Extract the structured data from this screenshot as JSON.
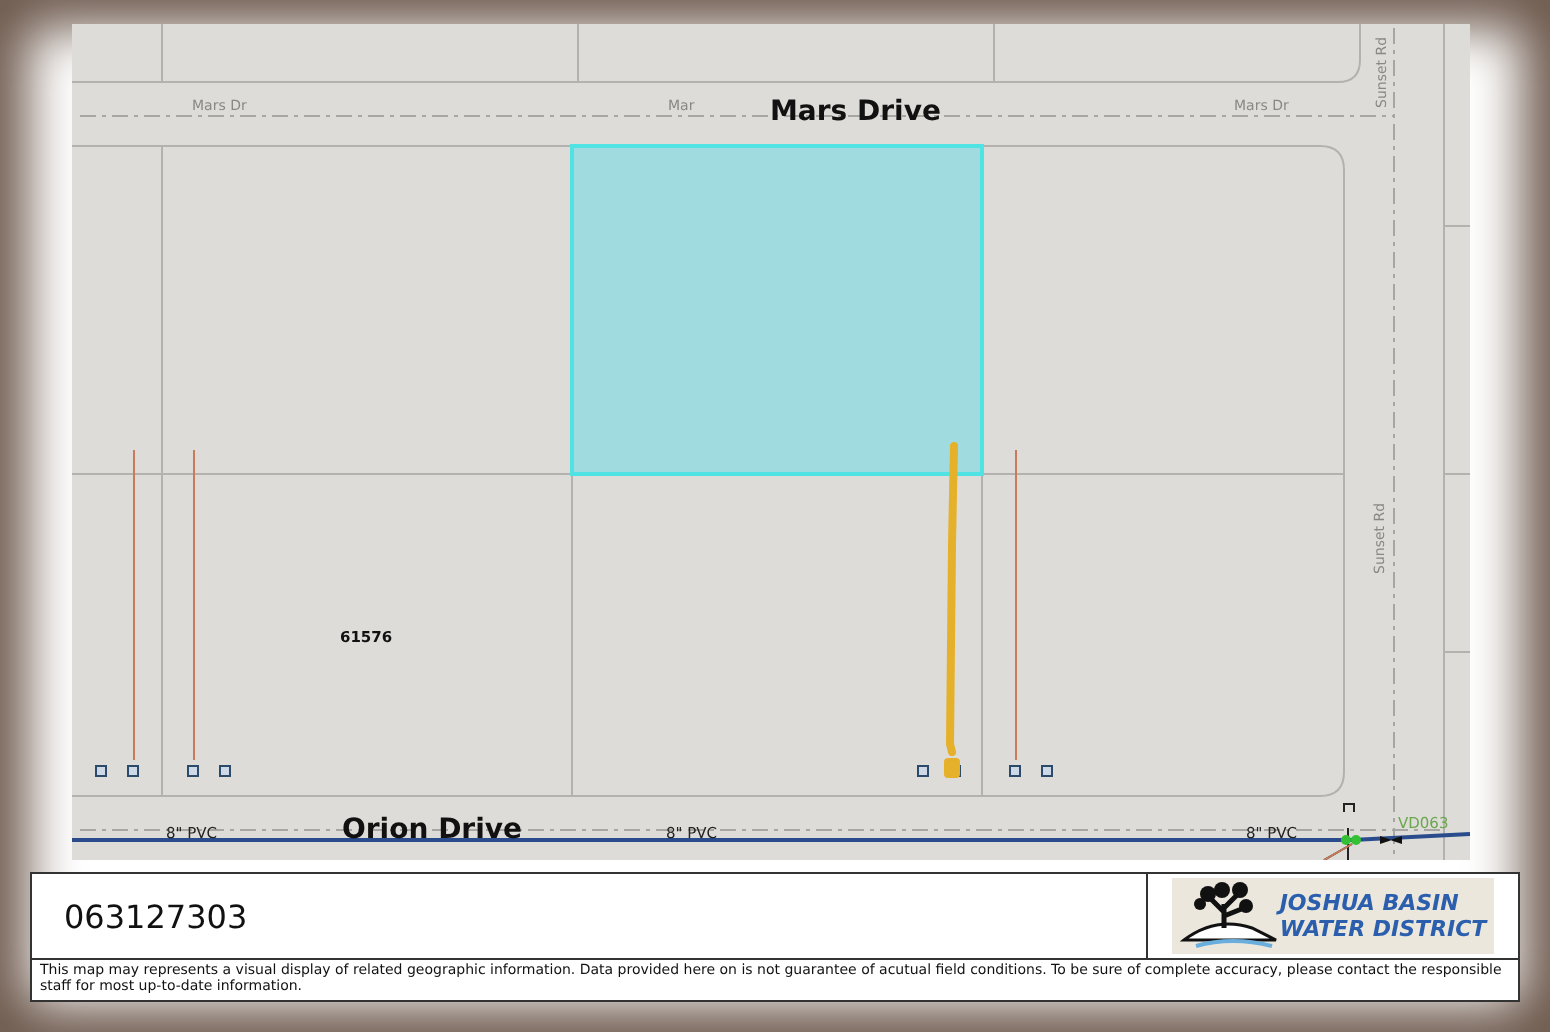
{
  "map": {
    "major_street_labels": [
      "Mars Drive",
      "Orion Drive"
    ],
    "minor_street_labels": [
      "Mars Dr",
      "Mar",
      "Mars Dr"
    ],
    "side_street_labels": [
      "Sunset Rd",
      "Sunset Rd"
    ],
    "parcel": {
      "highlighted": true
    },
    "parcel_number": "61576",
    "pipe_labels": [
      "8\" PVC",
      "8\" PVC",
      "8\" PVC"
    ],
    "valve_label": "VD063"
  },
  "footer": {
    "parcel_id": "063127303",
    "logo": {
      "line_1": "JOSHUA BASIN",
      "line_2": "WATER DISTRICT"
    },
    "disclaimer": "This map may represents a visual display of related geographic information. Data provided here on is not guarantee of acutual field conditions. To be sure of complete accuracy, please contact the responsible staff for most up-to-date information."
  }
}
